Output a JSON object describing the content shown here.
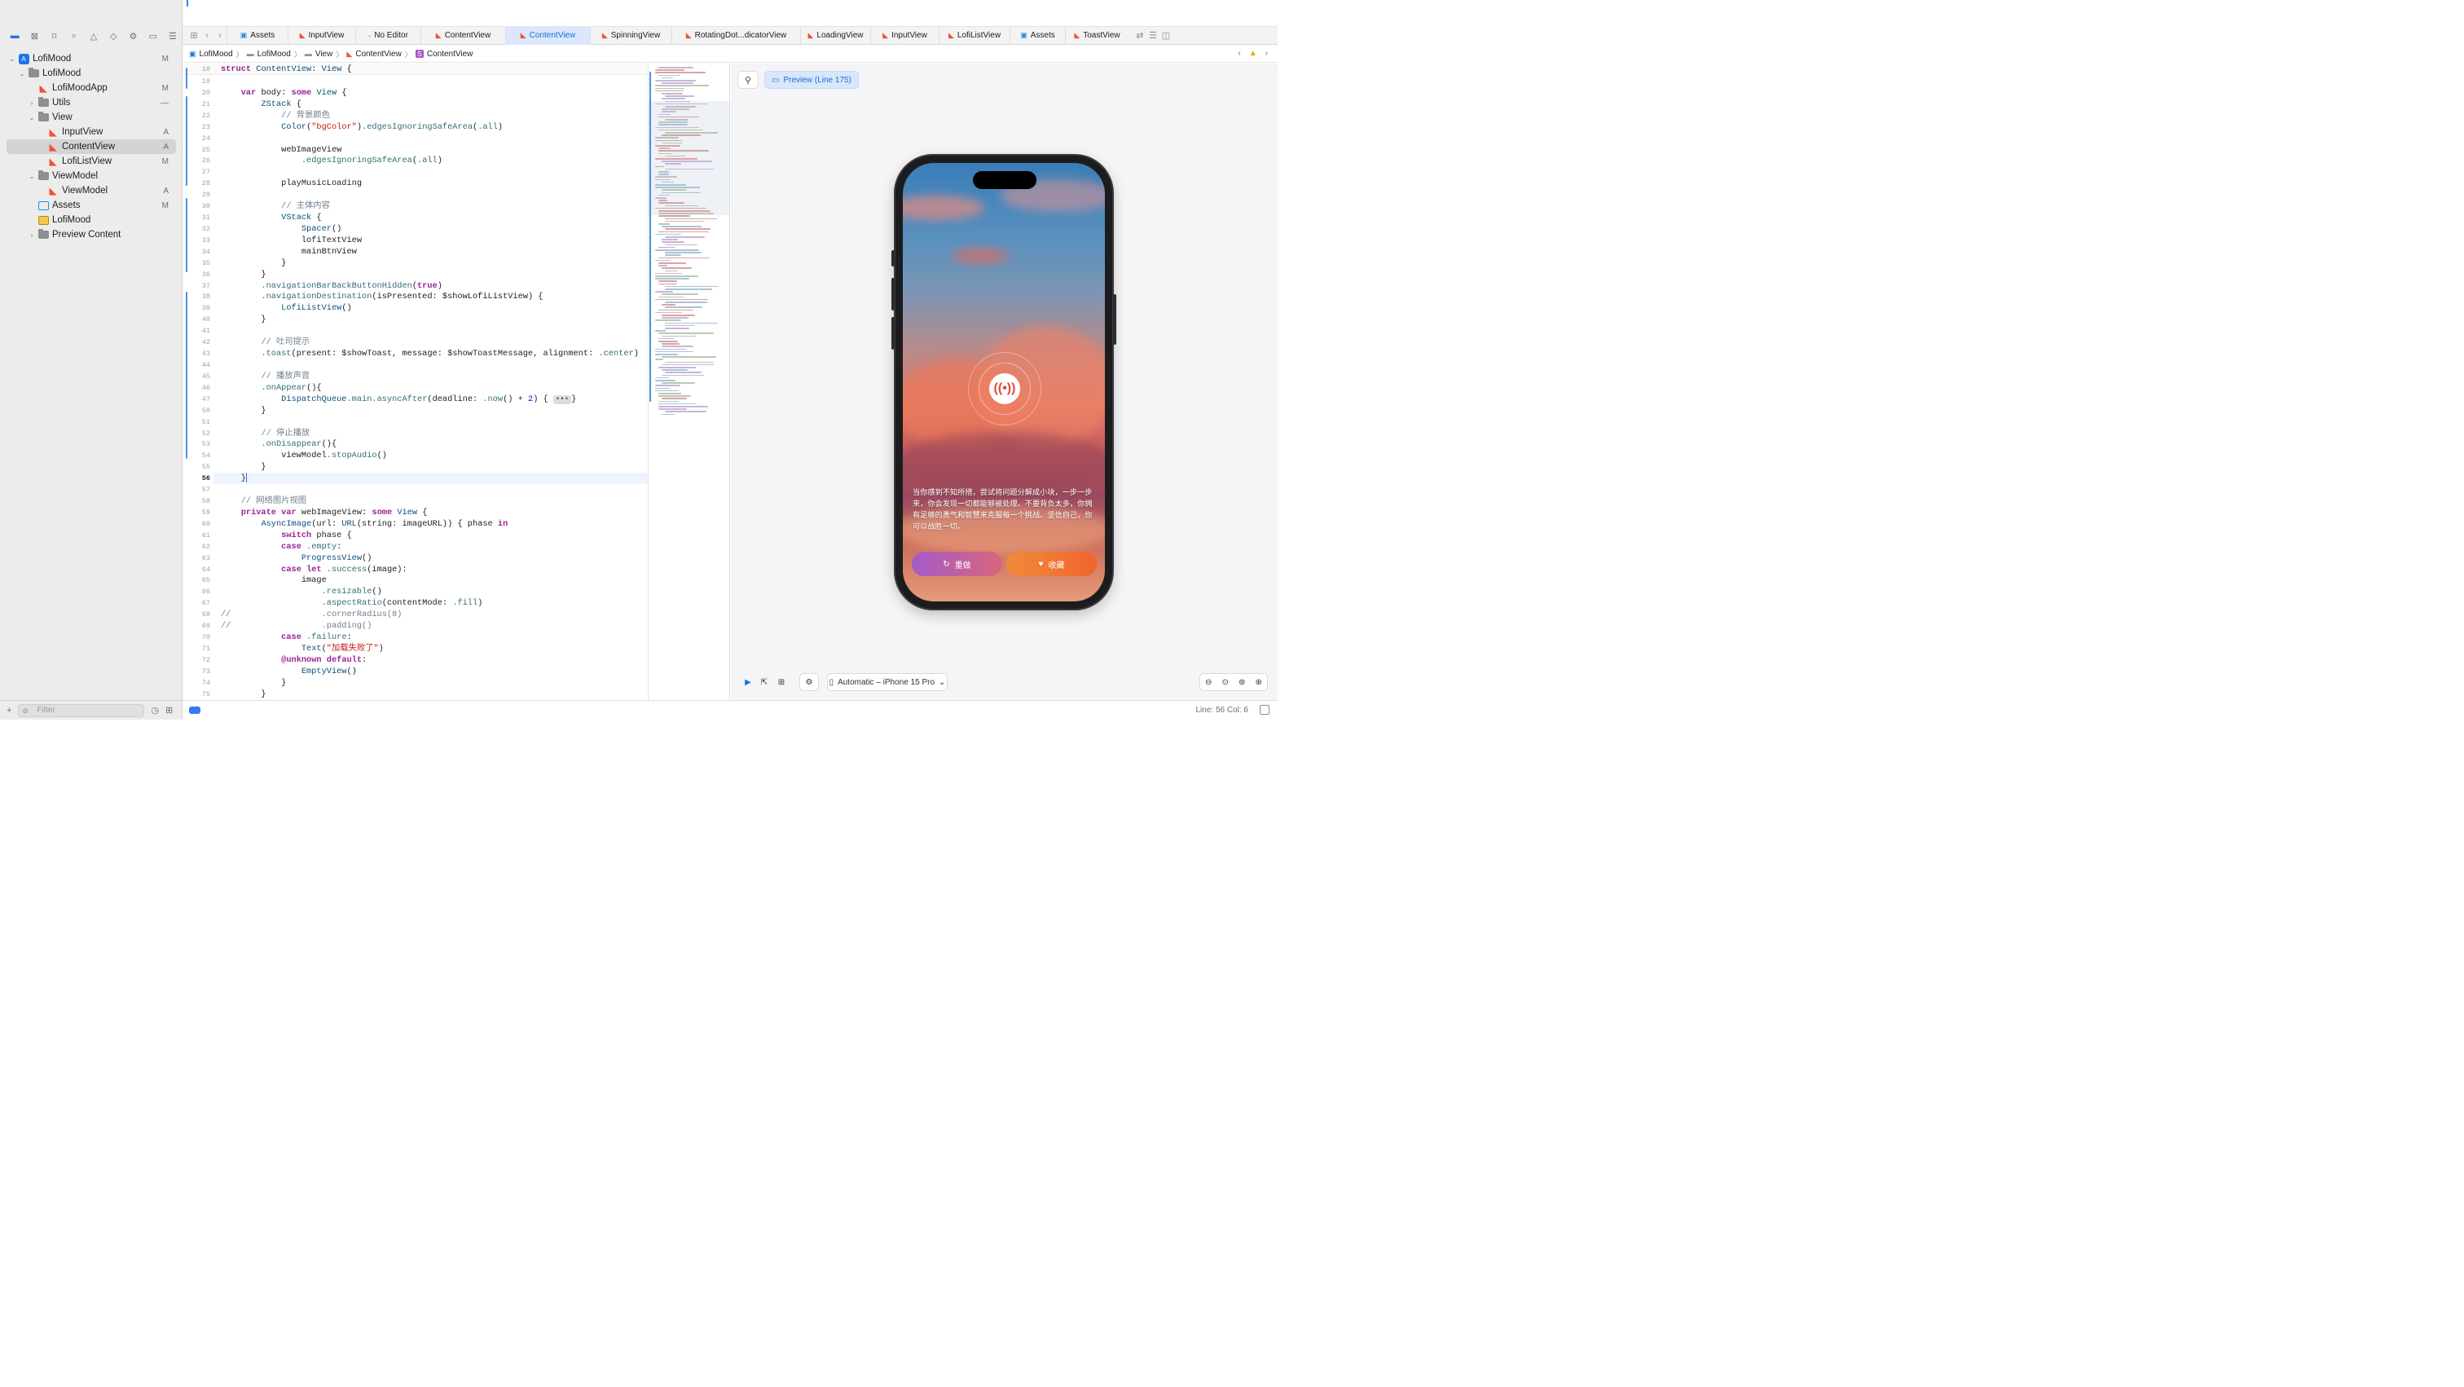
{
  "navigator": {
    "tree": [
      {
        "label": "LofiMood",
        "badge": "M",
        "icon": "project-icon",
        "disclosure": "open"
      },
      {
        "label": "LofiMood",
        "badge": "",
        "icon": "folder-icon",
        "disclosure": "open"
      },
      {
        "label": "LofiMoodApp",
        "badge": "M",
        "icon": "swift-file-icon",
        "disclosure": ""
      },
      {
        "label": "Utils",
        "badge": "—",
        "icon": "folder-icon",
        "disclosure": "closed"
      },
      {
        "label": "View",
        "badge": "",
        "icon": "folder-icon",
        "disclosure": "open"
      },
      {
        "label": "InputView",
        "badge": "A",
        "icon": "swift-file-icon",
        "disclosure": ""
      },
      {
        "label": "ContentView",
        "badge": "A",
        "icon": "swift-file-icon",
        "disclosure": "",
        "selected": true
      },
      {
        "label": "LofiListView",
        "badge": "M",
        "icon": "swift-file-icon",
        "disclosure": ""
      },
      {
        "label": "ViewModel",
        "badge": "",
        "icon": "folder-icon",
        "disclosure": "open"
      },
      {
        "label": "ViewModel",
        "badge": "A",
        "icon": "swift-file-icon",
        "disclosure": ""
      },
      {
        "label": "Assets",
        "badge": "M",
        "icon": "assets-icon",
        "disclosure": ""
      },
      {
        "label": "LofiMood",
        "badge": "",
        "icon": "lofi-file-icon",
        "disclosure": ""
      },
      {
        "label": "Preview Content",
        "badge": "",
        "icon": "folder-icon",
        "disclosure": "closed"
      }
    ],
    "filter_placeholder": "Filter"
  },
  "tabs": [
    {
      "label": "Assets",
      "icon": "assets-icon"
    },
    {
      "label": "InputView",
      "icon": "swift-icon"
    },
    {
      "label": "No Editor",
      "icon": "doc-icon"
    },
    {
      "label": "ContentView",
      "icon": "swift-icon"
    },
    {
      "label": "ContentView",
      "icon": "swift-icon",
      "active": true
    },
    {
      "label": "SpinningView",
      "icon": "swift-icon"
    },
    {
      "label": "RotatingDot...dicatorView",
      "icon": "swift-icon"
    },
    {
      "label": "LoadingView",
      "icon": "swift-icon"
    },
    {
      "label": "InputView",
      "icon": "swift-icon"
    },
    {
      "label": "LofiListView",
      "icon": "swift-icon"
    },
    {
      "label": "Assets",
      "icon": "assets-icon"
    },
    {
      "label": "ToastView",
      "icon": "swift-icon"
    }
  ],
  "breadcrumb": [
    "LofiMood",
    "LofiMood",
    "View",
    "ContentView",
    "ContentView"
  ],
  "code": {
    "lines": [
      {
        "n": "10",
        "t": "struct ContentView: View {",
        "sticky": true
      },
      {
        "n": "19",
        "t": ""
      },
      {
        "n": "20",
        "t": "    var body: some View {"
      },
      {
        "n": "21",
        "t": "        ZStack {"
      },
      {
        "n": "22",
        "t": "            // 背景颜色"
      },
      {
        "n": "23",
        "t": "            Color(\"bgColor\").edgesIgnoringSafeArea(.all)"
      },
      {
        "n": "24",
        "t": ""
      },
      {
        "n": "25",
        "t": "            webImageView"
      },
      {
        "n": "26",
        "t": "                .edgesIgnoringSafeArea(.all)"
      },
      {
        "n": "27",
        "t": ""
      },
      {
        "n": "28",
        "t": "            playMusicLoading"
      },
      {
        "n": "29",
        "t": ""
      },
      {
        "n": "30",
        "t": "            // 主体内容"
      },
      {
        "n": "31",
        "t": "            VStack {"
      },
      {
        "n": "32",
        "t": "                Spacer()"
      },
      {
        "n": "33",
        "t": "                lofiTextView"
      },
      {
        "n": "34",
        "t": "                mainBtnView"
      },
      {
        "n": "35",
        "t": "            }"
      },
      {
        "n": "36",
        "t": "        }"
      },
      {
        "n": "37",
        "t": "        .navigationBarBackButtonHidden(true)"
      },
      {
        "n": "38",
        "t": "        .navigationDestination(isPresented: $showLofiListView) {"
      },
      {
        "n": "39",
        "t": "            LofiListView()"
      },
      {
        "n": "40",
        "t": "        }"
      },
      {
        "n": "41",
        "t": ""
      },
      {
        "n": "42",
        "t": "        // 吐司提示"
      },
      {
        "n": "43",
        "t": "        .toast(present: $showToast, message: $showToastMessage, alignment: .center)"
      },
      {
        "n": "44",
        "t": ""
      },
      {
        "n": "45",
        "t": "        // 播放声音"
      },
      {
        "n": "46",
        "t": "        .onAppear(){"
      },
      {
        "n": "47",
        "t": "            DispatchQueue.main.asyncAfter(deadline: .now() + 2) {",
        "fold": "•••",
        "after": "}"
      },
      {
        "n": "50",
        "t": "        }"
      },
      {
        "n": "51",
        "t": ""
      },
      {
        "n": "52",
        "t": "        // 停止播放"
      },
      {
        "n": "53",
        "t": "        .onDisappear(){"
      },
      {
        "n": "54",
        "t": "            viewModel.stopAudio()"
      },
      {
        "n": "55",
        "t": "        }"
      },
      {
        "n": "56",
        "t": "    }",
        "current": true
      },
      {
        "n": "57",
        "t": ""
      },
      {
        "n": "58",
        "t": "    // 网络图片视图"
      },
      {
        "n": "59",
        "t": "    private var webImageView: some View {"
      },
      {
        "n": "60",
        "t": "        AsyncImage(url: URL(string: imageURL)) { phase in"
      },
      {
        "n": "61",
        "t": "            switch phase {"
      },
      {
        "n": "62",
        "t": "            case .empty:"
      },
      {
        "n": "63",
        "t": "                ProgressView()"
      },
      {
        "n": "64",
        "t": "            case let .success(image):"
      },
      {
        "n": "65",
        "t": "                image"
      },
      {
        "n": "66",
        "t": "                    .resizable()"
      },
      {
        "n": "67",
        "t": "                    .aspectRatio(contentMode: .fill)"
      },
      {
        "n": "68",
        "t": "//                  .cornerRadius(8)"
      },
      {
        "n": "69",
        "t": "//                  .padding()"
      },
      {
        "n": "70",
        "t": "            case .failure:"
      },
      {
        "n": "71",
        "t": "                Text(\"加载失败了\")"
      },
      {
        "n": "72",
        "t": "            @unknown default:"
      },
      {
        "n": "73",
        "t": "                EmptyView()"
      },
      {
        "n": "74",
        "t": "            }"
      },
      {
        "n": "75",
        "t": "        }"
      }
    ]
  },
  "preview": {
    "chip_label": "Preview (Line 175)",
    "quote": "当你感到不知所措，尝试将问题分解成小块，一步一步来，你会发现一切都能够被处理。不要背负太多，你拥有足够的勇气和智慧来克服每一个挑战。坚信自己，你可以战胜一切。",
    "redo_label": "重做",
    "fav_label": "收藏",
    "device_label": "Automatic – iPhone 15 Pro",
    "device_chevron": "⌄"
  },
  "status": {
    "position": "Line: 56  Col: 6"
  },
  "colors": {
    "accent": "#1a73e8",
    "swift": "#f05138",
    "keyword": "#9b2393"
  }
}
